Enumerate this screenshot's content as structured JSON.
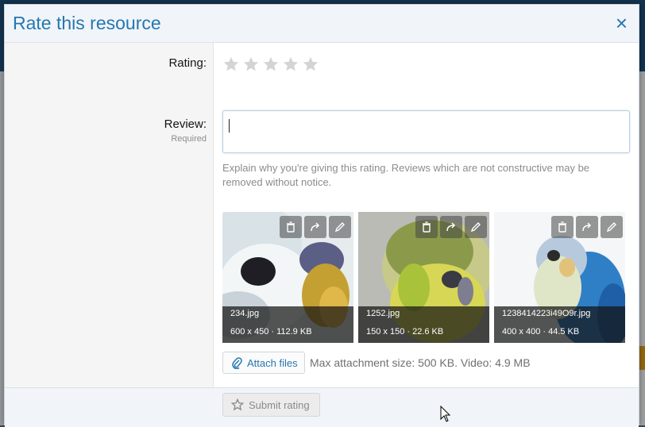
{
  "modal": {
    "title": "Rate this resource",
    "close_glyph": "×"
  },
  "rating": {
    "label": "Rating:",
    "stars": 5,
    "value": 0
  },
  "review": {
    "label": "Review:",
    "required": "Required",
    "value": "",
    "hint": "Explain why you're giving this rating. Reviews which are not constructive may be removed without notice."
  },
  "attachments": [
    {
      "name": "234.jpg",
      "meta": "600 x 450 · 112.9 KB"
    },
    {
      "name": "1252.jpg",
      "meta": "150 x 150 · 22.6 KB"
    },
    {
      "name": "1238414223i49O9r.jpg",
      "meta": "400 x 400 · 44.5 KB"
    }
  ],
  "attach": {
    "button_label": "Attach files",
    "limit_text": "Max attachment size: 500 KB. Video: 4.9 MB"
  },
  "footer": {
    "submit_label": "Submit rating"
  },
  "colors": {
    "accent": "#2577b1",
    "star_empty": "#d4d4d4"
  },
  "icons": [
    "close-icon",
    "star-icon",
    "trash-icon",
    "share-icon",
    "pencil-icon",
    "paperclip-icon",
    "cursor-icon"
  ]
}
